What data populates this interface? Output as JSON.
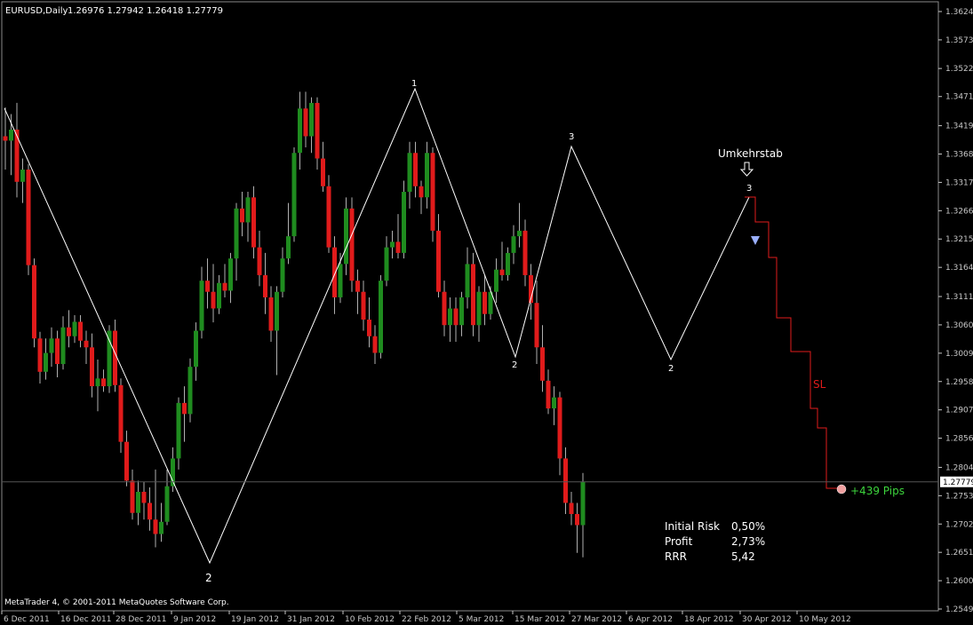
{
  "header": {
    "symbol": "EURUSD,Daily",
    "ohlc": "1.26976 1.27942 1.26418 1.27779"
  },
  "footer": {
    "copyright": "MetaTrader 4, © 2001-2011 MetaQuotes Software Corp."
  },
  "annotations": {
    "umkehrstab": "Umkehrstab",
    "sl": "SL",
    "pips": "+439 Pips",
    "wave_labels": [
      "1",
      "2",
      "3",
      "2",
      "3",
      "2"
    ],
    "stats": [
      {
        "label": "Initial Risk",
        "value": "0,50%"
      },
      {
        "label": "Profit",
        "value": "2,73%"
      },
      {
        "label": "RRR",
        "value": "5,42"
      }
    ]
  },
  "colors": {
    "bull": "#1f8c1f",
    "bear": "#e01b1b",
    "grid": "#1e2a3a",
    "text": "#ffffff",
    "axis": "#c8c8c8",
    "sl": "#e01b1b",
    "pips": "#3cd43c"
  },
  "chart_data": {
    "type": "candlestick",
    "title": "EURUSD,Daily",
    "current_price": "1.27779",
    "y_ticks": [
      "1.36245",
      "1.35735",
      "1.35220",
      "1.34715",
      "1.34190",
      "1.33680",
      "1.33170",
      "1.32660",
      "1.32150",
      "1.31640",
      "1.31115",
      "1.30605",
      "1.30095",
      "1.29585",
      "1.29075",
      "1.28565",
      "1.28040",
      "1.27530",
      "1.27020",
      "1.26510",
      "1.26000",
      "1.25490"
    ],
    "x_ticks": [
      "6 Dec 2011",
      "16 Dec 2011",
      "28 Dec 2011",
      "9 Jan 2012",
      "19 Jan 2012",
      "31 Jan 2012",
      "10 Feb 2012",
      "22 Feb 2012",
      "5 Mar 2012",
      "15 Mar 2012",
      "27 Mar 2012",
      "6 Apr 2012",
      "18 Apr 2012",
      "30 Apr 2012",
      "10 May 2012"
    ],
    "ylim": [
      1.2549,
      1.36245
    ],
    "candles": [
      [
        1.34,
        1.3452,
        1.334,
        1.3392
      ],
      [
        1.3392,
        1.344,
        1.333,
        1.3412
      ],
      [
        1.3412,
        1.346,
        1.329,
        1.3318
      ],
      [
        1.3318,
        1.336,
        1.328,
        1.334
      ],
      [
        1.334,
        1.335,
        1.315,
        1.3168
      ],
      [
        1.3168,
        1.318,
        1.302,
        1.3036
      ],
      [
        1.3036,
        1.3048,
        1.2955,
        1.2976
      ],
      [
        1.2976,
        1.3036,
        1.2962,
        1.301
      ],
      [
        1.301,
        1.3056,
        1.2985,
        1.3036
      ],
      [
        1.3036,
        1.305,
        1.2966,
        1.299
      ],
      [
        1.299,
        1.3076,
        1.298,
        1.3056
      ],
      [
        1.3056,
        1.3087,
        1.302,
        1.304
      ],
      [
        1.304,
        1.3078,
        1.3028,
        1.3066
      ],
      [
        1.3066,
        1.3078,
        1.302,
        1.3032
      ],
      [
        1.3032,
        1.305,
        1.299,
        1.302
      ],
      [
        1.302,
        1.3045,
        1.293,
        1.295
      ],
      [
        1.295,
        1.2998,
        1.2905,
        1.2964
      ],
      [
        1.2964,
        1.298,
        1.294,
        1.295
      ],
      [
        1.295,
        1.306,
        1.2938,
        1.305
      ],
      [
        1.305,
        1.307,
        1.294,
        1.2952
      ],
      [
        1.2952,
        1.2964,
        1.283,
        1.285
      ],
      [
        1.285,
        1.287,
        1.277,
        1.278
      ],
      [
        1.278,
        1.28,
        1.271,
        1.2722
      ],
      [
        1.2722,
        1.278,
        1.27,
        1.276
      ],
      [
        1.276,
        1.2778,
        1.271,
        1.274
      ],
      [
        1.274,
        1.2768,
        1.269,
        1.271
      ],
      [
        1.271,
        1.28,
        1.266,
        1.2684
      ],
      [
        1.2684,
        1.274,
        1.267,
        1.2706
      ],
      [
        1.2706,
        1.28,
        1.27,
        1.277
      ],
      [
        1.277,
        1.284,
        1.276,
        1.282
      ],
      [
        1.282,
        1.293,
        1.28,
        1.292
      ],
      [
        1.292,
        1.295,
        1.285,
        1.29
      ],
      [
        1.29,
        1.3,
        1.2885,
        1.2985
      ],
      [
        1.2985,
        1.3065,
        1.296,
        1.305
      ],
      [
        1.305,
        1.3165,
        1.3036,
        1.314
      ],
      [
        1.314,
        1.318,
        1.309,
        1.312
      ],
      [
        1.312,
        1.317,
        1.3065,
        1.309
      ],
      [
        1.309,
        1.315,
        1.308,
        1.3136
      ],
      [
        1.3136,
        1.317,
        1.311,
        1.3122
      ],
      [
        1.3122,
        1.319,
        1.31,
        1.318
      ],
      [
        1.318,
        1.328,
        1.314,
        1.327
      ],
      [
        1.327,
        1.33,
        1.322,
        1.3245
      ],
      [
        1.3245,
        1.33,
        1.321,
        1.329
      ],
      [
        1.329,
        1.331,
        1.318,
        1.32
      ],
      [
        1.32,
        1.323,
        1.313,
        1.315
      ],
      [
        1.315,
        1.319,
        1.308,
        1.311
      ],
      [
        1.311,
        1.313,
        1.303,
        1.305
      ],
      [
        1.305,
        1.313,
        1.297,
        1.312
      ],
      [
        1.312,
        1.32,
        1.311,
        1.318
      ],
      [
        1.318,
        1.328,
        1.317,
        1.322
      ],
      [
        1.322,
        1.338,
        1.321,
        1.337
      ],
      [
        1.337,
        1.348,
        1.334,
        1.345
      ],
      [
        1.345,
        1.348,
        1.338,
        1.34
      ],
      [
        1.34,
        1.347,
        1.337,
        1.346
      ],
      [
        1.346,
        1.347,
        1.334,
        1.336
      ],
      [
        1.336,
        1.339,
        1.33,
        1.331
      ],
      [
        1.331,
        1.333,
        1.319,
        1.32
      ],
      [
        1.32,
        1.322,
        1.308,
        1.311
      ],
      [
        1.311,
        1.319,
        1.31,
        1.317
      ],
      [
        1.317,
        1.329,
        1.315,
        1.327
      ],
      [
        1.327,
        1.329,
        1.312,
        1.314
      ],
      [
        1.314,
        1.316,
        1.308,
        1.312
      ],
      [
        1.312,
        1.314,
        1.305,
        1.307
      ],
      [
        1.307,
        1.311,
        1.302,
        1.304
      ],
      [
        1.304,
        1.306,
        1.299,
        1.301
      ],
      [
        1.301,
        1.315,
        1.3,
        1.314
      ],
      [
        1.314,
        1.322,
        1.313,
        1.32
      ],
      [
        1.32,
        1.323,
        1.318,
        1.321
      ],
      [
        1.321,
        1.326,
        1.318,
        1.319
      ],
      [
        1.319,
        1.332,
        1.318,
        1.33
      ],
      [
        1.33,
        1.339,
        1.327,
        1.337
      ],
      [
        1.337,
        1.339,
        1.329,
        1.331
      ],
      [
        1.331,
        1.332,
        1.326,
        1.329
      ],
      [
        1.329,
        1.339,
        1.327,
        1.337
      ],
      [
        1.337,
        1.338,
        1.321,
        1.323
      ],
      [
        1.323,
        1.326,
        1.311,
        1.312
      ],
      [
        1.312,
        1.314,
        1.304,
        1.306
      ],
      [
        1.306,
        1.311,
        1.303,
        1.309
      ],
      [
        1.309,
        1.311,
        1.303,
        1.306
      ],
      [
        1.306,
        1.312,
        1.304,
        1.311
      ],
      [
        1.311,
        1.32,
        1.309,
        1.317
      ],
      [
        1.317,
        1.319,
        1.304,
        1.306
      ],
      [
        1.306,
        1.313,
        1.303,
        1.312
      ],
      [
        1.312,
        1.315,
        1.306,
        1.308
      ],
      [
        1.308,
        1.313,
        1.307,
        1.312
      ],
      [
        1.312,
        1.318,
        1.31,
        1.316
      ],
      [
        1.316,
        1.321,
        1.314,
        1.315
      ],
      [
        1.315,
        1.32,
        1.314,
        1.319
      ],
      [
        1.319,
        1.324,
        1.317,
        1.322
      ],
      [
        1.322,
        1.328,
        1.32,
        1.323
      ],
      [
        1.323,
        1.325,
        1.313,
        1.315
      ],
      [
        1.315,
        1.317,
        1.307,
        1.31
      ],
      [
        1.31,
        1.314,
        1.299,
        1.302
      ],
      [
        1.302,
        1.306,
        1.294,
        1.296
      ],
      [
        1.296,
        1.298,
        1.29,
        1.291
      ],
      [
        1.291,
        1.295,
        1.288,
        1.293
      ],
      [
        1.293,
        1.294,
        1.279,
        1.282
      ],
      [
        1.282,
        1.284,
        1.272,
        1.274
      ],
      [
        1.274,
        1.276,
        1.27,
        1.272
      ],
      [
        1.272,
        1.274,
        1.265,
        1.27
      ],
      [
        1.27,
        1.2794,
        1.2642,
        1.2778
      ]
    ]
  }
}
